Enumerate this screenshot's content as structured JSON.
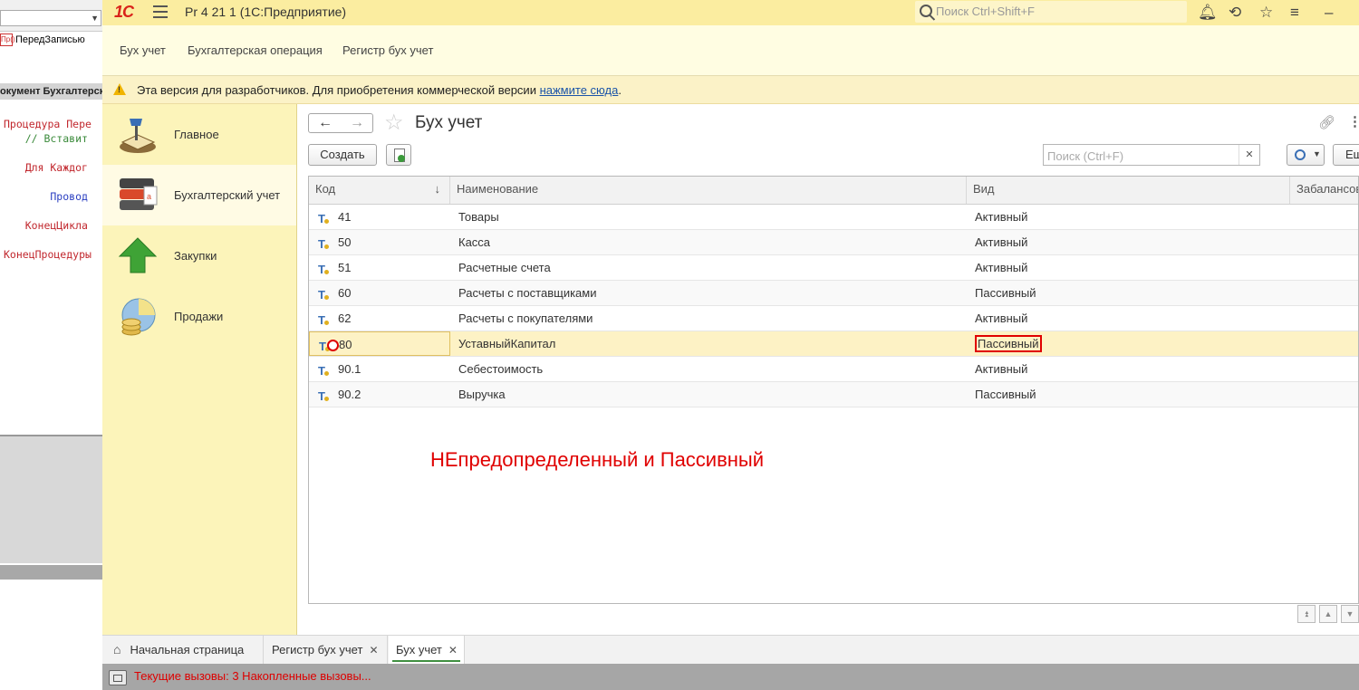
{
  "editor": {
    "proc_label": "ПередЗаписью",
    "proc_tag": "Пр()",
    "header": "окумент Бухгалтерск",
    "code_lines": [
      "Процедура Пере",
      "    // Вставит",
      "",
      "    Для Каждог",
      "",
      "        Провод",
      "",
      "    КонецЦикла",
      "",
      "КонецПроцедуры"
    ]
  },
  "window": {
    "logo": "1С",
    "title": "Pr 4 21 1  (1С:Предприятие)",
    "search_placeholder": "Поиск Ctrl+Shift+F"
  },
  "sections": [
    "Бух учет",
    "Бухгалтерская операция",
    "Регистр бух учет"
  ],
  "warning": {
    "text": "Эта версия для разработчиков. Для приобретения коммерческой версии ",
    "link": "нажмите сюда",
    "tail": "."
  },
  "nav": [
    {
      "label": "Главное",
      "icon": "desk-lamp-icon"
    },
    {
      "label": "Бухгалтерский учет",
      "icon": "binders-icon"
    },
    {
      "label": "Закупки",
      "icon": "green-arrow-up-icon"
    },
    {
      "label": "Продажи",
      "icon": "pie-coins-icon"
    }
  ],
  "form": {
    "title": "Бух учет",
    "create_label": "Создать",
    "search_placeholder": "Поиск (Ctrl+F)",
    "more_label": "Еще"
  },
  "grid": {
    "columns": [
      "Код",
      "Наименование",
      "Вид",
      "Забалансовый"
    ],
    "sort_indicator": "↓",
    "rows": [
      {
        "code": "41",
        "name": "Товары",
        "kind": "Активный"
      },
      {
        "code": "50",
        "name": "Касса",
        "kind": "Активный"
      },
      {
        "code": "51",
        "name": "Расчетные счета",
        "kind": "Активный"
      },
      {
        "code": "60",
        "name": "Расчеты с поставщиками",
        "kind": "Пассивный"
      },
      {
        "code": "62",
        "name": "Расчеты с покупателями",
        "kind": "Активный"
      },
      {
        "code": "80",
        "name": "УставныйКапитал",
        "kind": "Пассивный"
      },
      {
        "code": "90.1",
        "name": "Себестоимость",
        "kind": "Активный"
      },
      {
        "code": "90.2",
        "name": "Выручка",
        "kind": "Пассивный"
      }
    ],
    "selected_row": 5
  },
  "annotation": "НЕпредопределенный и Пассивный",
  "tabs": [
    {
      "label": "Начальная страница",
      "closable": false
    },
    {
      "label": "Регистр бух учет",
      "closable": true
    },
    {
      "label": "Бух учет",
      "closable": true,
      "active": true
    }
  ],
  "status": "Текущие вызовы: 3   Накопленные вызовы...",
  "colors": {
    "titlebar": "#fbeda0",
    "nav_panel": "#fcf4ba",
    "logo_red": "#d9231a",
    "annotation_red": "#e00000",
    "tab_accent": "#3f8f40"
  }
}
